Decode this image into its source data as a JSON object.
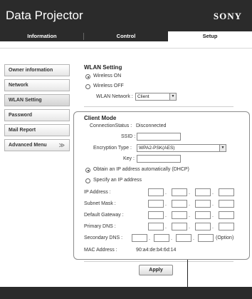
{
  "header": {
    "title": "Data Projector",
    "brand": "SONY"
  },
  "tabs": [
    {
      "label": "Information"
    },
    {
      "label": "Control"
    },
    {
      "label": "Setup"
    }
  ],
  "sidebar": {
    "items": [
      {
        "label": "Owner information"
      },
      {
        "label": "Network"
      },
      {
        "label": "WLAN Setting"
      },
      {
        "label": "Password"
      },
      {
        "label": "Mail Report"
      },
      {
        "label": "Advanced Menu"
      }
    ],
    "chevron": "≫"
  },
  "wlan": {
    "title": "WLAN Setting",
    "on_label": "Wireless ON",
    "off_label": "Wireless OFF",
    "network_label": "WLAN Network :",
    "network_value": "Client"
  },
  "client": {
    "title": "Client Mode",
    "status_label": "ConnectionStatus :",
    "status_value": "Disconnected",
    "ssid_label": "SSID :",
    "ssid_value": "",
    "enc_label": "Encryption Type :",
    "enc_value": "WPA2-PSK(AES)",
    "key_label": "Key :",
    "key_value": "",
    "dhcp_label": "Obtain an IP address automatically (DHCP)",
    "specify_label": "Specify an IP address",
    "ip_label": "IP Address :",
    "mask_label": "Subnet Mask :",
    "gateway_label": "Default Gateway :",
    "dns1_label": "Primary DNS :",
    "dns2_label": "Secondary DNS :",
    "option_label": "(Option)",
    "mac_label": "MAC Address :",
    "mac_value": "90:a4:de:b4:6d:14"
  },
  "apply_label": "Apply",
  "colors": {
    "header_bg": "#2b2b2b",
    "frame": "#8c8c8c"
  }
}
